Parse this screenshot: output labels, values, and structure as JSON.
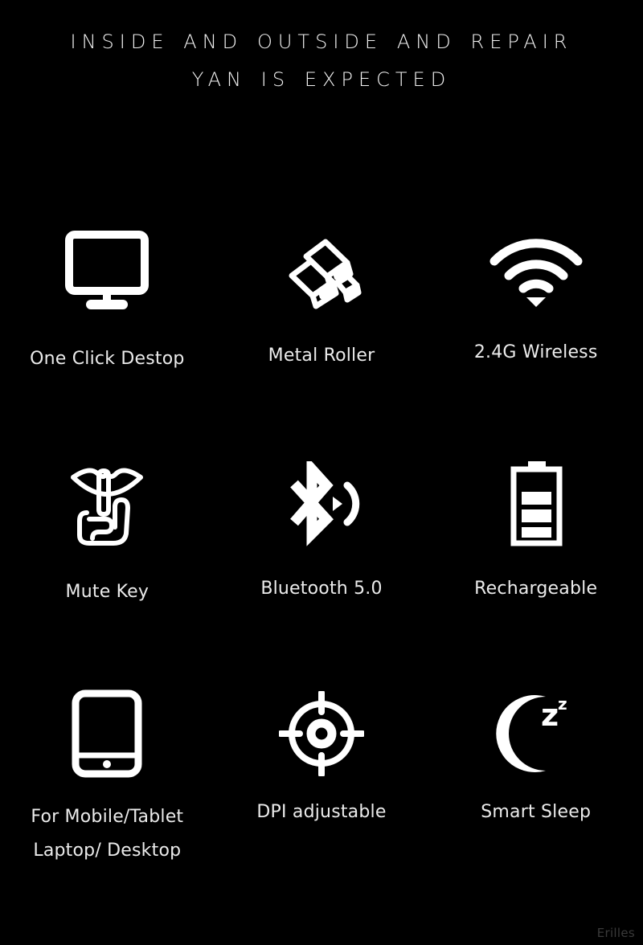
{
  "heading": {
    "line1": "Inside and outside and repair",
    "line2": "Yan is expected"
  },
  "colors": {
    "background": "#000000",
    "text": "#ebebeb",
    "icon": "#ffffff",
    "watermark": "#3a3a3a"
  },
  "features": {
    "rows": [
      {
        "cells": [
          {
            "icon": "monitor-icon",
            "label": "One Click Destop"
          },
          {
            "icon": "gold-bars-icon",
            "label": "Metal Roller"
          },
          {
            "icon": "wifi-icon",
            "label": "2.4G Wireless"
          }
        ]
      },
      {
        "cells": [
          {
            "icon": "shh-mute-gesture-icon",
            "label": "Mute Key"
          },
          {
            "icon": "bluetooth-icon",
            "label": "Bluetooth 5.0"
          },
          {
            "icon": "battery-icon",
            "label": "Rechargeable"
          }
        ]
      },
      {
        "cells": [
          {
            "icon": "tablet-icon",
            "label": "For Mobile/Tablet",
            "label_line2": "Laptop/ Desktop"
          },
          {
            "icon": "crosshair-target-icon",
            "label": "DPI adjustable"
          },
          {
            "icon": "moon-zzz-icon",
            "label": "Smart Sleep"
          }
        ]
      }
    ]
  },
  "watermark": {
    "text": "Erilles"
  }
}
